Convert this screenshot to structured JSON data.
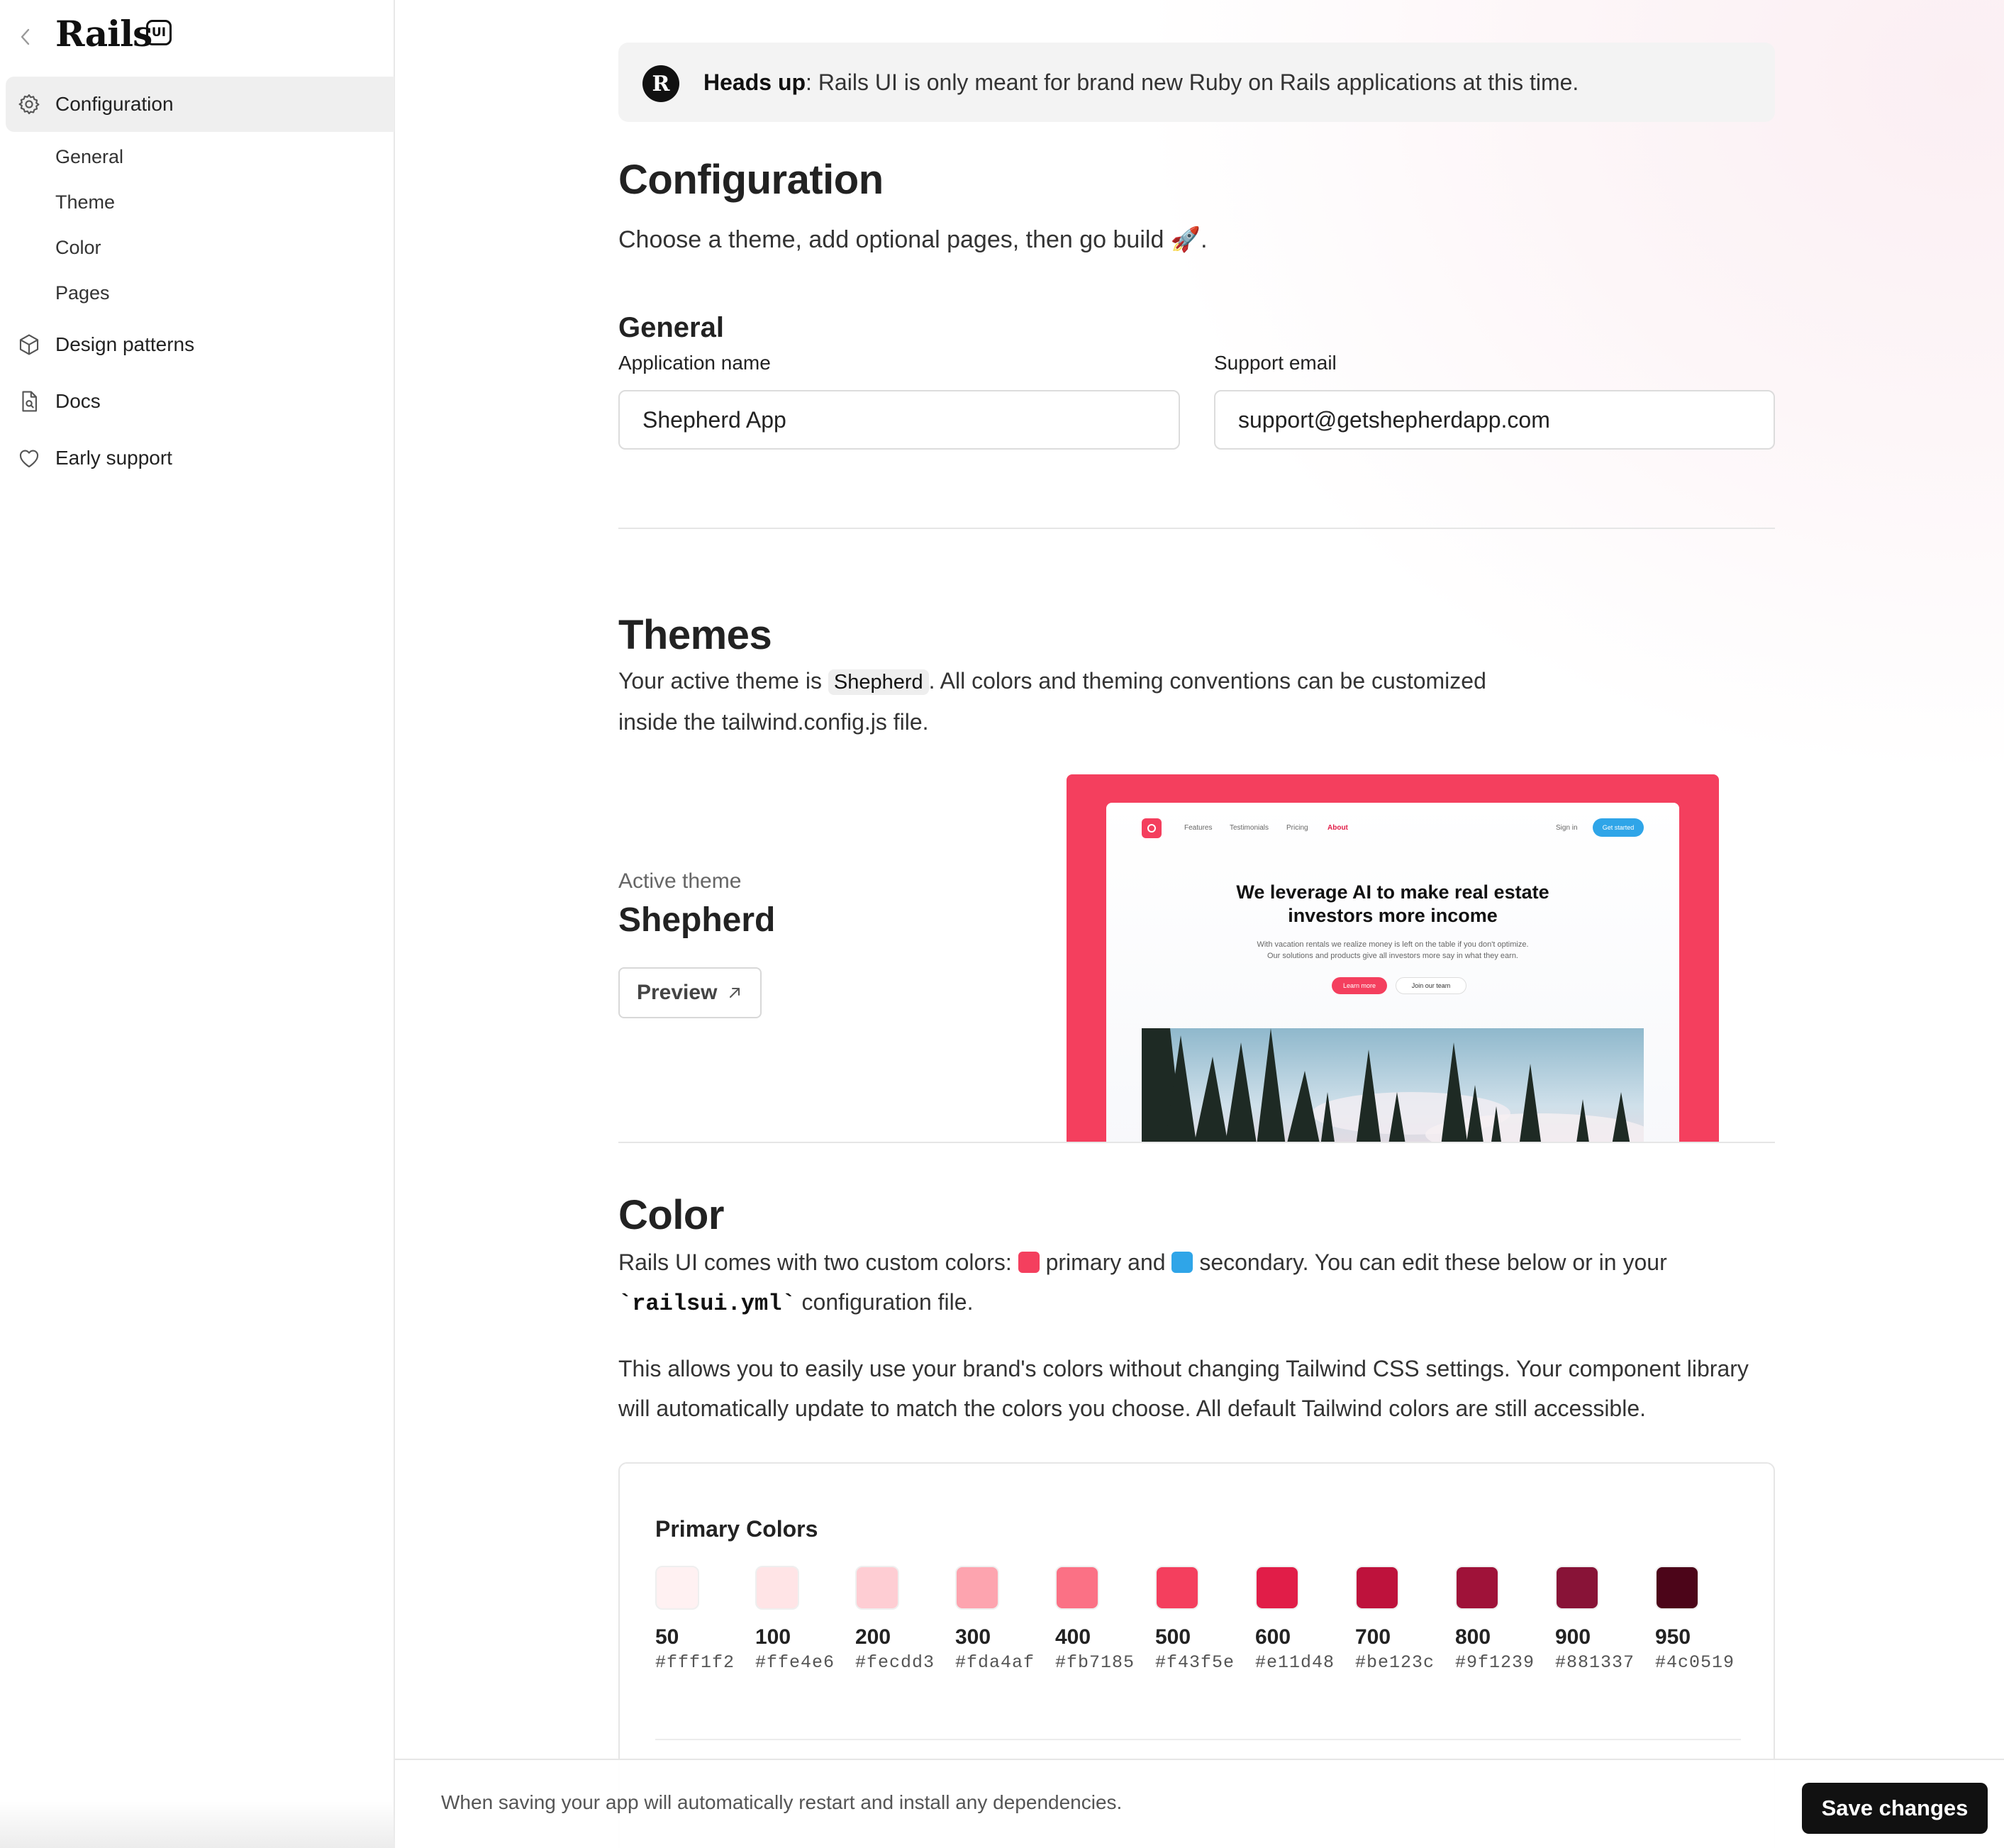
{
  "sidebar": {
    "logo_text": "Rails",
    "logo_badge": "UI",
    "items": [
      {
        "label": "Configuration",
        "icon": "gear-icon",
        "active": true
      },
      {
        "label": "Design patterns",
        "icon": "cube-icon"
      },
      {
        "label": "Docs",
        "icon": "document-search-icon"
      },
      {
        "label": "Early support",
        "icon": "heart-icon"
      }
    ],
    "sub_items": [
      "General",
      "Theme",
      "Color",
      "Pages"
    ]
  },
  "banner": {
    "strong": "Heads up",
    "text": ": Rails UI is only meant for brand new Ruby on Rails applications at this time."
  },
  "page": {
    "title": "Configuration",
    "subtitle": "Choose a theme, add optional pages, then go build 🚀."
  },
  "general": {
    "heading": "General",
    "app_name_label": "Application name",
    "app_name_value": "Shepherd App",
    "email_label": "Support email",
    "email_value": "support@getshepherdapp.com"
  },
  "themes": {
    "heading": "Themes",
    "desc_before": "Your active theme is ",
    "theme_pill": "Shepherd",
    "desc_after": ". All colors and theming conventions can be customized",
    "desc_line2": "inside the tailwind.config.js file.",
    "active_label": "Active theme",
    "active_name": "Shepherd",
    "preview_button": "Preview",
    "preview_card": {
      "nav": [
        "Features",
        "Testimonials",
        "Pricing",
        "About"
      ],
      "sign_in": "Sign in",
      "get_started": "Get started",
      "headline_1": "We leverage AI to make real estate",
      "headline_2": "investors more income",
      "sub_1": "With vacation rentals we realize money is left on the table if you don't optimize.",
      "sub_2": "Our solutions and products give all investors more say in what they earn.",
      "learn_more": "Learn more",
      "join_team": "Join our team"
    }
  },
  "color": {
    "heading": "Color",
    "line1_a": "Rails UI comes with two custom colors: ",
    "primary_word": " primary and ",
    "secondary_word": " secondary. You can edit these below or in your",
    "config_file": "`railsui.yml`",
    "line2_rest": " configuration file.",
    "para2_line1": "This allows you to easily use your brand's colors without changing Tailwind CSS settings. Your component library",
    "para2_line2": "will automatically update to match the colors you choose. All default Tailwind colors are still accessible.",
    "primary_color": "#f43f5e",
    "secondary_color": "#2fa5e8"
  },
  "primary_colors": {
    "title": "Primary Colors",
    "shades": [
      {
        "name": "50",
        "hex": "#fff1f2"
      },
      {
        "name": "100",
        "hex": "#ffe4e6"
      },
      {
        "name": "200",
        "hex": "#fecdd3"
      },
      {
        "name": "300",
        "hex": "#fda4af"
      },
      {
        "name": "400",
        "hex": "#fb7185"
      },
      {
        "name": "500",
        "hex": "#f43f5e"
      },
      {
        "name": "600",
        "hex": "#e11d48"
      },
      {
        "name": "700",
        "hex": "#be123c"
      },
      {
        "name": "800",
        "hex": "#9f1239"
      },
      {
        "name": "900",
        "hex": "#881337"
      },
      {
        "name": "950",
        "hex": "#4c0519"
      }
    ]
  },
  "footer": {
    "note": "When saving your app will automatically restart and install any dependencies.",
    "save_button": "Save changes"
  }
}
